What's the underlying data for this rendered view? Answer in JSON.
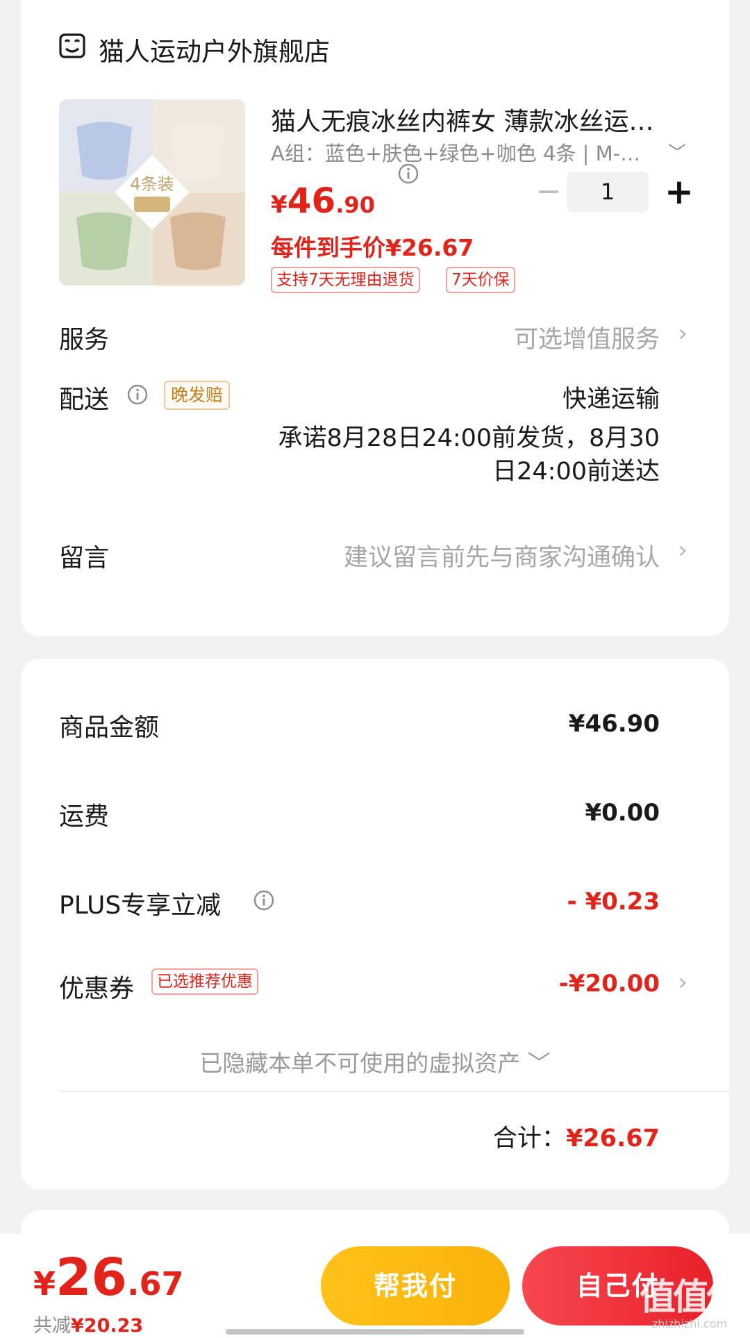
{
  "store": {
    "icon": "store-icon",
    "name": "猫人运动户外旗舰店"
  },
  "product": {
    "image_badge": "4条装",
    "image_caption": "蓝色+肤色+绿色+咖色",
    "title": "猫人无痕冰丝内裤女 薄款冰丝运…",
    "spec": "A组：蓝色+肤色+绿色+咖色 4条 | M-…",
    "price_currency": "¥",
    "price_int": "46",
    "price_dec": ".90",
    "quantity": "1",
    "minus_label": "−",
    "plus_label": "+",
    "unit_price": "每件到手价¥26.67",
    "tags": [
      "支持7天无理由退货",
      "7天价保"
    ]
  },
  "service": {
    "label": "服务",
    "value": "可选增值服务"
  },
  "delivery": {
    "label": "配送",
    "badge": "晚发赔",
    "method": "快递运输",
    "promise_line1": "承诺8月28日24:00前发货，8月30",
    "promise_line2": "日24:00前送达"
  },
  "message": {
    "label": "留言",
    "placeholder": "建议留言前先与商家沟通确认"
  },
  "summary": {
    "goods_label": "商品金额",
    "goods_value": "¥46.90",
    "shipping_label": "运费",
    "shipping_value": "¥0.00",
    "plus_label": "PLUS专享立减",
    "plus_value": "- ¥0.23",
    "coupon_label": "优惠券",
    "coupon_badge": "已选推荐优惠",
    "coupon_value": "-¥20.00",
    "hidden_assets": "已隐藏本单不可使用的虚拟资产",
    "total_label": "合计：",
    "total_value": "¥26.67"
  },
  "bottom": {
    "price_currency": "¥",
    "price_int": "26",
    "price_dec": ".67",
    "saved_label": "共减",
    "saved_value": "¥20.23",
    "help_pay": "帮我付",
    "self_pay": "自己付"
  },
  "watermark": {
    "logo": "值值值",
    "url": "zhizhizhi.com"
  },
  "colors": {
    "accent_red": "#e2231a",
    "accent_yellow": "#ffc21a",
    "late_badge": "#c47f1f"
  }
}
